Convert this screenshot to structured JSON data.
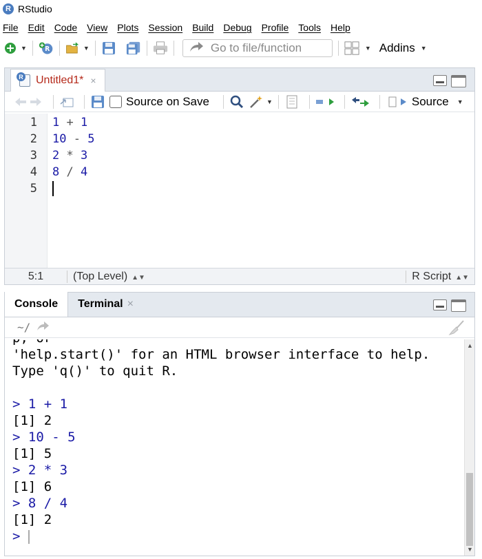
{
  "window": {
    "title": "RStudio",
    "icon": "R"
  },
  "menu": [
    "File",
    "Edit",
    "Code",
    "View",
    "Plots",
    "Session",
    "Build",
    "Debug",
    "Profile",
    "Tools",
    "Help"
  ],
  "toolbar": {
    "goto_placeholder": "Go to file/function",
    "addins_label": "Addins"
  },
  "source": {
    "tab_label": "Untitled1*",
    "tab_close": "×",
    "source_on_save_label": "Source on Save",
    "source_button_label": "Source",
    "line_numbers": [
      "1",
      "2",
      "3",
      "4",
      "5"
    ],
    "lines": [
      {
        "a": "1",
        "op": "+",
        "b": "1"
      },
      {
        "a": "10",
        "op": "-",
        "b": "5"
      },
      {
        "a": "2",
        "op": "*",
        "b": "3"
      },
      {
        "a": "8",
        "op": "/",
        "b": "4"
      }
    ],
    "status": {
      "position": "5:1",
      "scope": "(Top Level)",
      "file_type": "R Script"
    }
  },
  "console": {
    "tabs": [
      {
        "label": "Console",
        "active": true
      },
      {
        "label": "Terminal",
        "close": "×"
      }
    ],
    "path": "~/",
    "output": [
      {
        "text": "p, or",
        "type": "out"
      },
      {
        "text": "'help.start()' for an HTML browser interface to help.",
        "type": "out"
      },
      {
        "text": "Type 'q()' to quit R.",
        "type": "out"
      },
      {
        "text": "",
        "type": "out"
      },
      {
        "text": "> 1 + 1",
        "type": "cmd"
      },
      {
        "text": "[1] 2",
        "type": "out"
      },
      {
        "text": "> 10 - 5",
        "type": "cmd"
      },
      {
        "text": "[1] 5",
        "type": "out"
      },
      {
        "text": "> 2 * 3",
        "type": "cmd"
      },
      {
        "text": "[1] 6",
        "type": "out"
      },
      {
        "text": "> 8 / 4",
        "type": "cmd"
      },
      {
        "text": "[1] 2",
        "type": "out"
      }
    ],
    "prompt": ">"
  },
  "colors": {
    "code_blue": "#1a1aa6",
    "tab_red": "#b5291a",
    "pane_header": "#e4e9ef"
  }
}
